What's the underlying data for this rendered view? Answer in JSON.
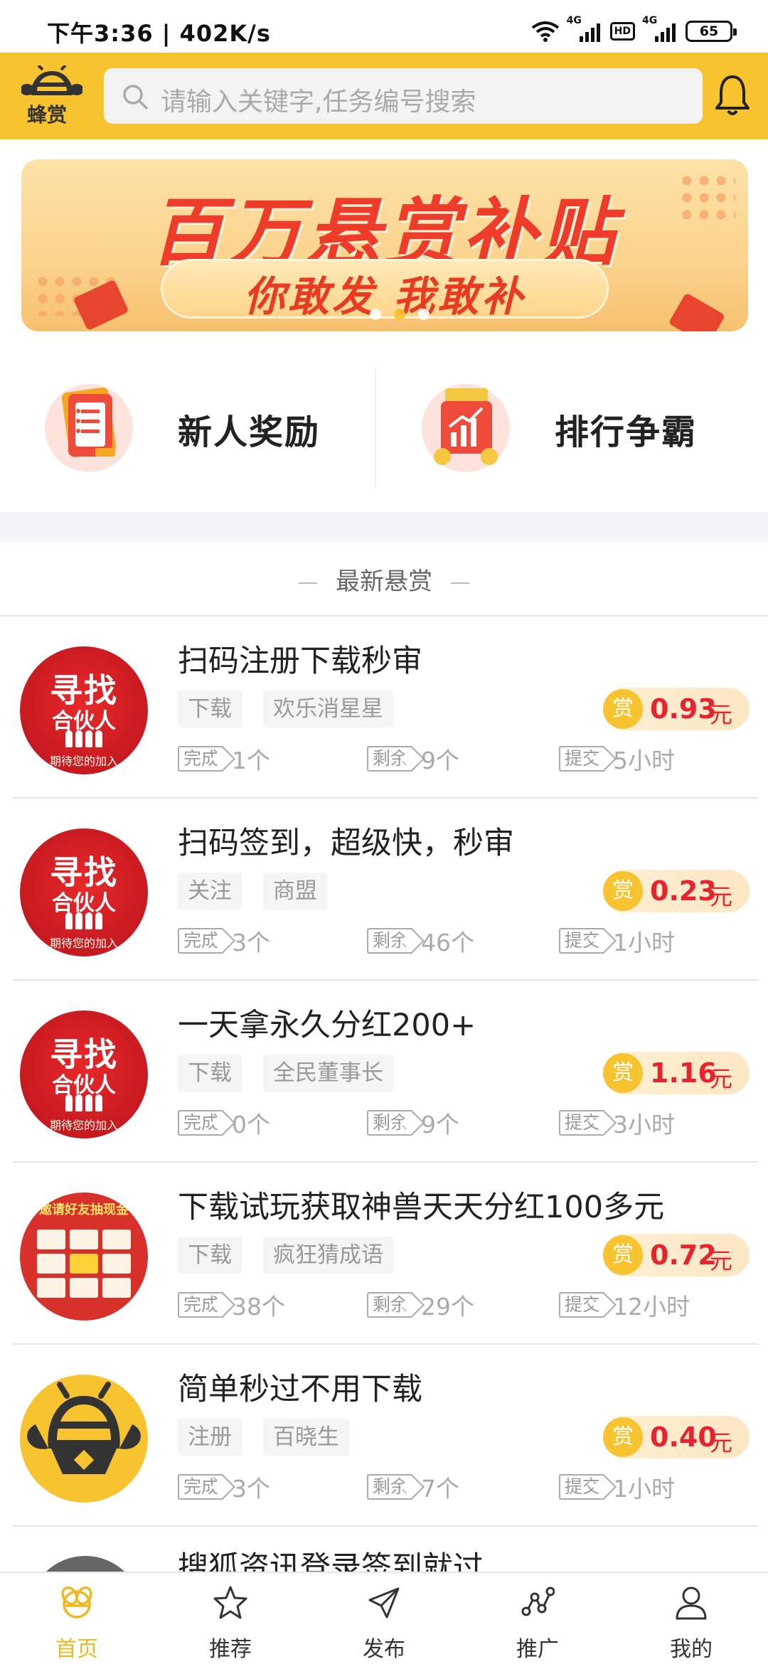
{
  "status_bar": {
    "time": "下午3:36 | 402K/s",
    "network_1": "4G",
    "hd": "HD",
    "network_2": "4G",
    "battery": "65"
  },
  "header": {
    "logo_text": "蜂赏",
    "search_placeholder": "请输入关键字,任务编号搜索"
  },
  "banner": {
    "title": "百万悬赏补贴",
    "subtitle": "你敢发 我敢补",
    "pages": 3,
    "active_page": 2
  },
  "features": [
    {
      "label": "新人奖励",
      "icon": "gift-document-icon"
    },
    {
      "label": "排行争霸",
      "icon": "ranking-chart-icon"
    }
  ],
  "section_title": "最新悬赏",
  "task_labels": {
    "done": "完成",
    "remaining": "剩余",
    "submit": "提交",
    "reward_prefix": "赏",
    "currency": "元"
  },
  "tasks": [
    {
      "title": "扫码注册下载秒审",
      "tags": [
        "下载",
        "欢乐消星星"
      ],
      "reward": "0.93",
      "done": "1个",
      "remaining": "9个",
      "submit": "5小时",
      "avatar": "partner"
    },
    {
      "title": "扫码签到，超级快，秒审",
      "tags": [
        "关注",
        "商盟"
      ],
      "reward": "0.23",
      "done": "3个",
      "remaining": "46个",
      "submit": "1小时",
      "avatar": "partner"
    },
    {
      "title": "一天拿永久分红200+",
      "tags": [
        "下载",
        "全民董事长"
      ],
      "reward": "1.16",
      "done": "0个",
      "remaining": "9个",
      "submit": "3小时",
      "avatar": "partner"
    },
    {
      "title": "下载试玩获取神兽天天分红100多元",
      "tags": [
        "下载",
        "疯狂猜成语"
      ],
      "reward": "0.72",
      "done": "38个",
      "remaining": "29个",
      "submit": "12小时",
      "avatar": "invite"
    },
    {
      "title": "简单秒过不用下载",
      "tags": [
        "注册",
        "百晓生"
      ],
      "reward": "0.40",
      "done": "3个",
      "remaining": "7个",
      "submit": "1小时",
      "avatar": "bee"
    }
  ],
  "partner_avatar": {
    "line1": "寻找",
    "line2": "合伙人",
    "line3": "期待您的加入"
  },
  "invite_avatar": {
    "line1": "邀请好友抽现金"
  },
  "peek_task": {
    "title": "搜狐资讯登录签到就过"
  },
  "bottom_nav": [
    {
      "label": "首页",
      "icon": "home-bee-icon",
      "active": true
    },
    {
      "label": "推荐",
      "icon": "star-icon",
      "active": false
    },
    {
      "label": "发布",
      "icon": "send-icon",
      "active": false
    },
    {
      "label": "推广",
      "icon": "share-nodes-icon",
      "active": false
    },
    {
      "label": "我的",
      "icon": "user-icon",
      "active": false
    }
  ],
  "colors": {
    "brand_yellow": "#f7c430",
    "reward_red": "#e8232d"
  }
}
